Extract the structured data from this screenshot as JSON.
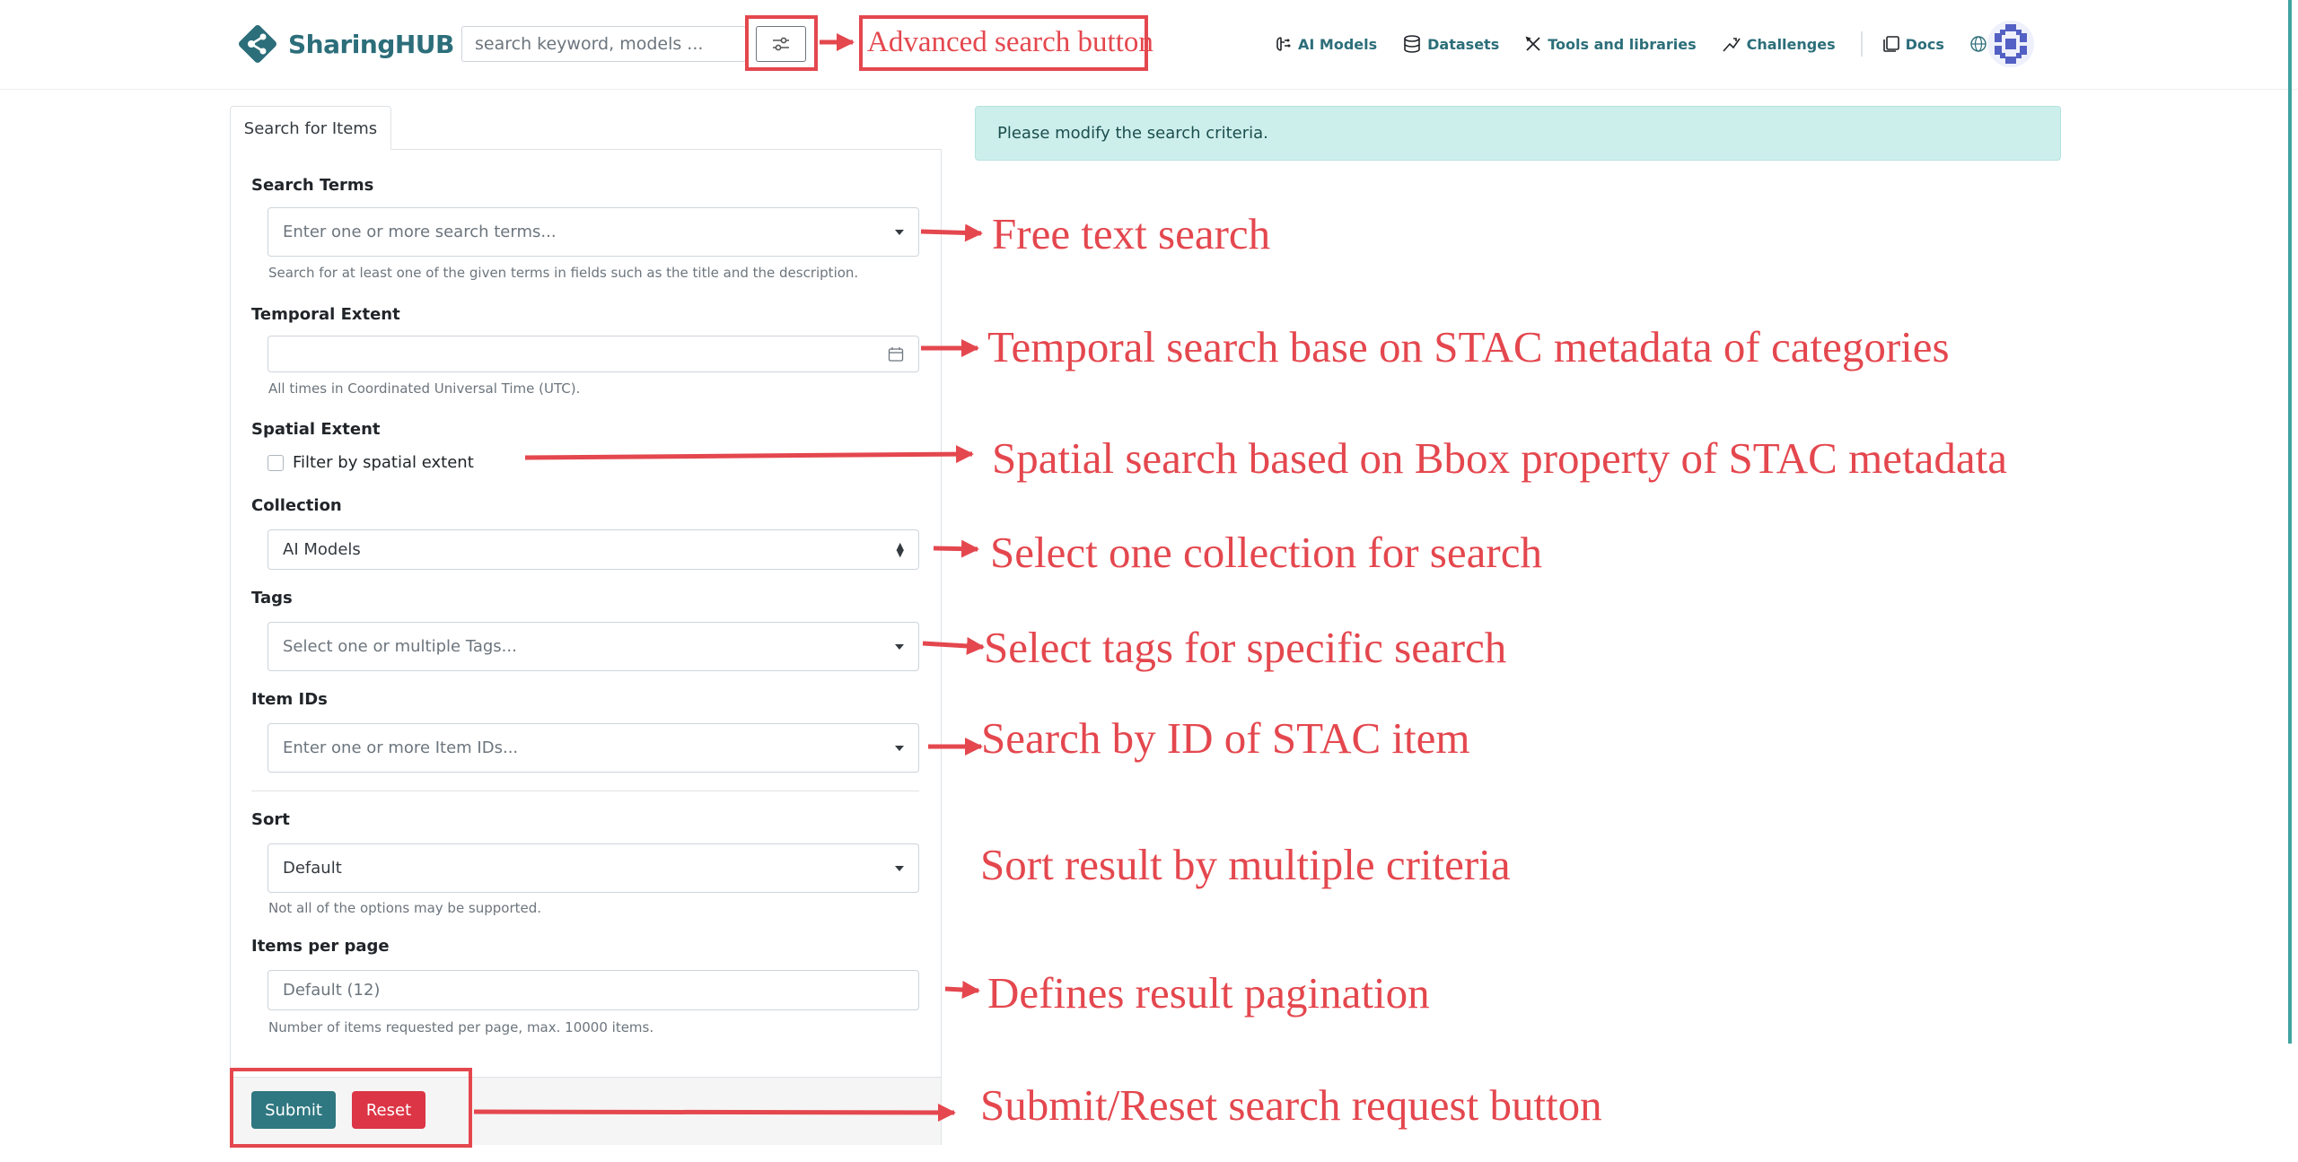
{
  "navbar": {
    "brand": "SharingHUB",
    "search_placeholder": "search keyword, models ...",
    "links": [
      {
        "label": "AI Models",
        "icon": "brain-icon"
      },
      {
        "label": "Datasets",
        "icon": "database-icon"
      },
      {
        "label": "Tools and libraries",
        "icon": "tools-icon"
      },
      {
        "label": "Challenges",
        "icon": "challenge-icon"
      },
      {
        "label": "Docs",
        "icon": "book-icon"
      }
    ],
    "language": "en"
  },
  "form": {
    "tab_label": "Search for Items",
    "search_terms": {
      "label": "Search Terms",
      "placeholder": "Enter one or more search terms...",
      "help": "Search for at least one of the given terms in fields such as the title and the description."
    },
    "temporal": {
      "label": "Temporal Extent",
      "help": "All times in Coordinated Universal Time (UTC)."
    },
    "spatial": {
      "label": "Spatial Extent",
      "checkbox_label": "Filter by spatial extent",
      "checked": false
    },
    "collection": {
      "label": "Collection",
      "value": "AI Models"
    },
    "tags": {
      "label": "Tags",
      "placeholder": "Select one or multiple Tags..."
    },
    "item_ids": {
      "label": "Item IDs",
      "placeholder": "Enter one or more Item IDs..."
    },
    "sort": {
      "label": "Sort",
      "value": "Default",
      "help": "Not all of the options may be supported."
    },
    "items_per_page": {
      "label": "Items per page",
      "placeholder": "Default (12)",
      "help": "Number of items requested per page, max. 10000 items."
    },
    "submit_label": "Submit",
    "reset_label": "Reset"
  },
  "alert": {
    "message": "Please modify the search criteria."
  },
  "annotations": {
    "advanced_search": "Advanced search button",
    "free_text": "Free text search",
    "temporal": "Temporal search base on STAC metadata of categories",
    "spatial": "Spatial search based on Bbox property of STAC metadata",
    "collection": "Select one collection for search",
    "tags": "Select tags for specific search",
    "item_id": "Search by ID of STAC item",
    "sort": "Sort result by multiple criteria",
    "pagination": "Defines result pagination",
    "submit_reset": "Submit/Reset search request button"
  },
  "colors": {
    "brand": "#2c6e7a",
    "annotation": "#e4474e",
    "submit": "#2f7781",
    "reset": "#dc3545",
    "alert_bg": "#cdefec"
  }
}
